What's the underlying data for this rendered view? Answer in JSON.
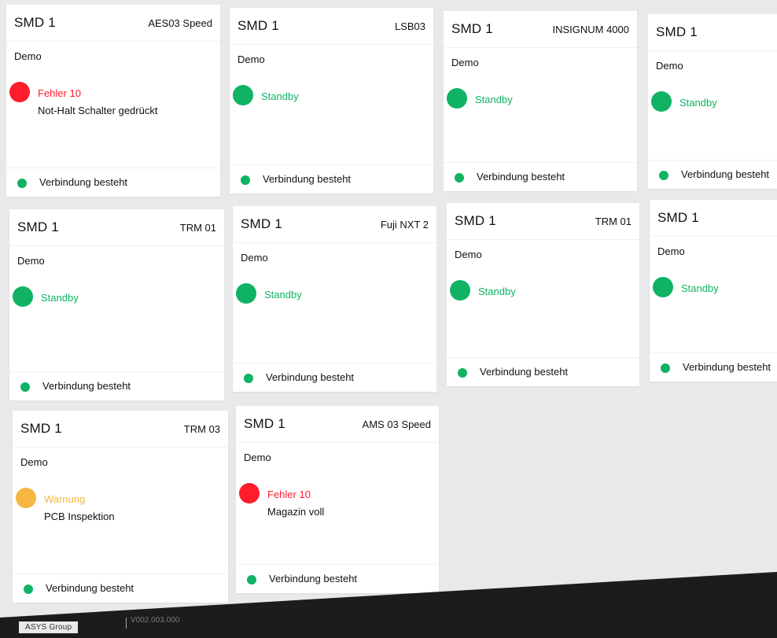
{
  "colors": {
    "green": "#0fb363",
    "red": "#ff1c2d",
    "orange": "#f5b742",
    "bg": "#e9e9ea",
    "card": "#ffffff",
    "dark": "#1c1c1c"
  },
  "cards": [
    {
      "title": "SMD 1",
      "model": "AES03 Speed",
      "site": "Demo",
      "status": "Fehler 10",
      "status_type": "error",
      "message": "Not-Halt Schalter gedrückt",
      "connection": "Verbindung besteht"
    },
    {
      "title": "SMD 1",
      "model": "LSB03",
      "site": "Demo",
      "status": "Standby",
      "status_type": "ok",
      "message": "",
      "connection": "Verbindung besteht"
    },
    {
      "title": "SMD 1",
      "model": "INSIGNUM 4000",
      "site": "Demo",
      "status": "Standby",
      "status_type": "ok",
      "message": "",
      "connection": "Verbindung besteht"
    },
    {
      "title": "SMD 1",
      "model": "",
      "site": "Demo",
      "status": "Standby",
      "status_type": "ok",
      "message": "",
      "connection": "Verbindung besteht"
    },
    {
      "title": "SMD 1",
      "model": "TRM 01",
      "site": "Demo",
      "status": "Standby",
      "status_type": "ok",
      "message": "",
      "connection": "Verbindung besteht"
    },
    {
      "title": "SMD 1",
      "model": "Fuji NXT 2",
      "site": "Demo",
      "status": "Standby",
      "status_type": "ok",
      "message": "",
      "connection": "Verbindung besteht"
    },
    {
      "title": "SMD 1",
      "model": "TRM 01",
      "site": "Demo",
      "status": "Standby",
      "status_type": "ok",
      "message": "",
      "connection": "Verbindung besteht"
    },
    {
      "title": "SMD 1",
      "model": "",
      "site": "Demo",
      "status": "Standby",
      "status_type": "ok",
      "message": "",
      "connection": "Verbindung besteht"
    },
    {
      "title": "SMD 1",
      "model": "TRM 03",
      "site": "Demo",
      "status": "Warnung",
      "status_type": "warning",
      "message": "PCB Inspektion",
      "connection": "Verbindung besteht"
    },
    {
      "title": "SMD 1",
      "model": "AMS 03 Speed",
      "site": "Demo",
      "status": "Fehler 10",
      "status_type": "error",
      "message": "Magazin voll",
      "connection": "Verbindung besteht"
    }
  ],
  "footer": {
    "brand": "ASYS Group",
    "version": "V002.003.000"
  }
}
